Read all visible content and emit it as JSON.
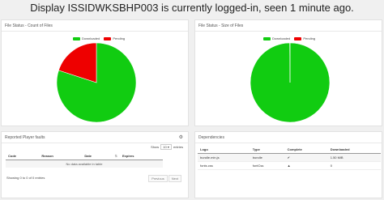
{
  "header": {
    "title": "Display ISSIDWKSBHP003 is currently logged-in, seen 1 minute ago."
  },
  "colors": {
    "downloaded": "#11cc11",
    "pending": "#ee0000"
  },
  "files_count_panel": {
    "title": "File Status - Count of Files",
    "legend": [
      {
        "label": "Downloaded",
        "color": "#11cc11"
      },
      {
        "label": "Pending",
        "color": "#ee0000"
      }
    ]
  },
  "files_size_panel": {
    "title": "File Status - Size of Files",
    "legend": [
      {
        "label": "Downloaded",
        "color": "#11cc11"
      },
      {
        "label": "Pending",
        "color": "#ee0000"
      }
    ]
  },
  "chart_data": [
    {
      "type": "pie",
      "title": "File Status - Count of Files",
      "categories": [
        "Downloaded",
        "Pending"
      ],
      "values": [
        80,
        20
      ]
    },
    {
      "type": "pie",
      "title": "File Status - Size of Files",
      "categories": [
        "Downloaded",
        "Pending"
      ],
      "values": [
        99.9,
        0.1
      ]
    }
  ],
  "faults_panel": {
    "title": "Reported Player faults",
    "show_label": "Show",
    "entries_value": "10",
    "entries_label": "entries",
    "columns": [
      "Code",
      "Reason",
      "Date",
      "Expires"
    ],
    "empty_message": "No data available in table",
    "info": "Showing 0 to 0 of 0 entries",
    "prev": "Previous",
    "next": "Next"
  },
  "dependencies_panel": {
    "title": "Dependencies",
    "columns": [
      "Logo",
      "Type",
      "Complete",
      "Downloaded"
    ],
    "rows": [
      {
        "logo": "bundle.min.js",
        "type": "bundle",
        "complete": "✔",
        "downloaded": "1.50 MiB"
      },
      {
        "logo": "fonts.css",
        "type": "fontCss",
        "complete": "▲",
        "downloaded": "0"
      }
    ]
  }
}
